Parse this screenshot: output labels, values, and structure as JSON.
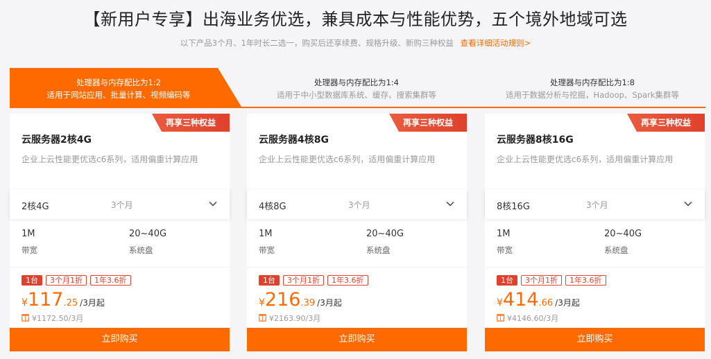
{
  "header": {
    "title": "【新用户专享】出海业务优选，兼具成本与性能优势，五个境外地域可选",
    "subtitle": "以下产品3个月、1年时长二选一，购买后还享续费、规格升级、新购三种权益",
    "rules_link": "查看详细活动规则>"
  },
  "tabs": [
    {
      "title": "处理器与内存配比为1:2",
      "desc": "适用于网站应用、批量计算、视频编码等",
      "active": true
    },
    {
      "title": "处理器与内存配比为1:4",
      "desc": "适用于中小型数据库系统、缓存、搜索集群等",
      "active": false
    },
    {
      "title": "处理器与内存配比为1:8",
      "desc": "适用于数据分析与挖掘，Hadoop、Spark集群等",
      "active": false
    }
  ],
  "colors": {
    "accent": "#ff6a00",
    "badge": "#e0412c"
  },
  "cards": [
    {
      "badge": "再享三种权益",
      "title": "云服务器2核4G",
      "desc": "企业上云性能更优选c6系列，适用偏重计算应用",
      "spec": "2核4G",
      "duration": "3个月",
      "bandwidth_value": "1M",
      "bandwidth_label": "带宽",
      "disk_value": "20~40G",
      "disk_label": "系统盘",
      "tags": [
        "1台",
        "3个月1折",
        "1年3.6折"
      ],
      "yen": "¥",
      "price_int": "117",
      "price_dec": ".25",
      "price_unit": "/3月起",
      "original": "¥1172.50/3月",
      "buy_label": "立即购买"
    },
    {
      "badge": "再享三种权益",
      "title": "云服务器4核8G",
      "desc": "企业上云性能更优选c6系列，适用偏重计算应用",
      "spec": "4核8G",
      "duration": "3个月",
      "bandwidth_value": "1M",
      "bandwidth_label": "带宽",
      "disk_value": "20~40G",
      "disk_label": "系统盘",
      "tags": [
        "1台",
        "3个月1折",
        "1年3.6折"
      ],
      "yen": "¥",
      "price_int": "216",
      "price_dec": ".39",
      "price_unit": "/3月起",
      "original": "¥2163.90/3月",
      "buy_label": "立即购买"
    },
    {
      "badge": "再享三种权益",
      "title": "云服务器8核16G",
      "desc": "企业上云性能更优选c6系列，适用偏重计算应用",
      "spec": "8核16G",
      "duration": "3个月",
      "bandwidth_value": "1M",
      "bandwidth_label": "带宽",
      "disk_value": "20~40G",
      "disk_label": "系统盘",
      "tags": [
        "1台",
        "3个月1折",
        "1年3.6折"
      ],
      "yen": "¥",
      "price_int": "414",
      "price_dec": ".66",
      "price_unit": "/3月起",
      "original": "¥4146.60/3月",
      "buy_label": "立即购买"
    }
  ]
}
